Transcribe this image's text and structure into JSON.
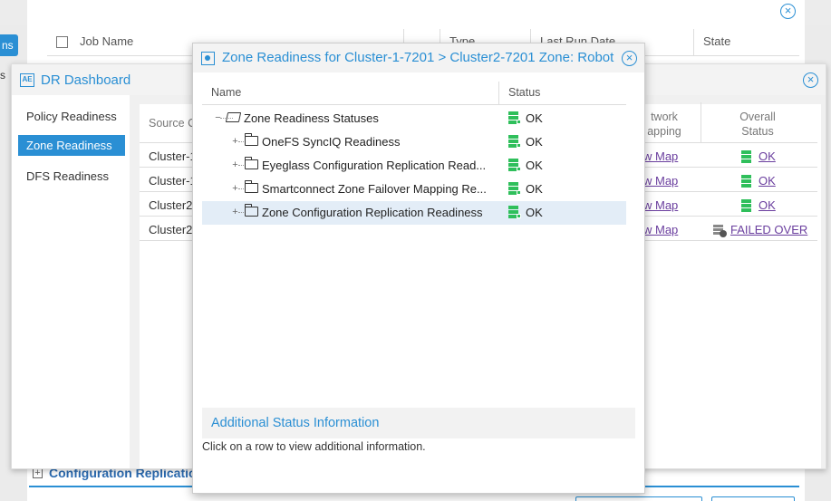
{
  "jobs": {
    "tab_label": "ns",
    "side_text": "s",
    "columns": [
      "Job Name",
      "Type",
      "Last Run Date",
      "State"
    ],
    "bottom_section": "Configuration Replication"
  },
  "dr_dashboard": {
    "title": "DR Dashboard",
    "nav": [
      "Policy Readiness",
      "Zone Readiness",
      "DFS Readiness"
    ],
    "active_nav": "Zone Readiness",
    "headers": {
      "source": "Source C",
      "network": "twork\napping",
      "overall": "Overall\nStatus"
    },
    "rows": [
      {
        "source": "Cluster-1",
        "network": "w Map",
        "status": "OK"
      },
      {
        "source": "Cluster-1",
        "network": "w Map",
        "status": "OK"
      },
      {
        "source": "Cluster2",
        "network": "w Map",
        "status": "OK"
      },
      {
        "source": "Cluster2",
        "network": "w Map",
        "status": "FAILED OVER"
      }
    ]
  },
  "modal": {
    "title": "Zone Readiness for Cluster-1-7201 > Cluster2-7201 Zone: Robot",
    "columns": {
      "name": "Name",
      "status": "Status"
    },
    "tree": [
      {
        "label": "Zone Readiness Statuses",
        "status": "OK",
        "level": 0
      },
      {
        "label": "OneFS SyncIQ Readiness",
        "status": "OK",
        "level": 1
      },
      {
        "label": "Eyeglass Configuration Replication Read...",
        "status": "OK",
        "level": 1
      },
      {
        "label": "Smartconnect Zone Failover Mapping Re...",
        "status": "OK",
        "level": 1
      },
      {
        "label": "Zone Configuration Replication Readiness",
        "status": "OK",
        "level": 1
      }
    ],
    "additional_title": "Additional Status Information",
    "additional_hint": "Click on a row to view additional information.",
    "status_color": "#2fbf5b",
    "accent": "#2a8fd4"
  }
}
